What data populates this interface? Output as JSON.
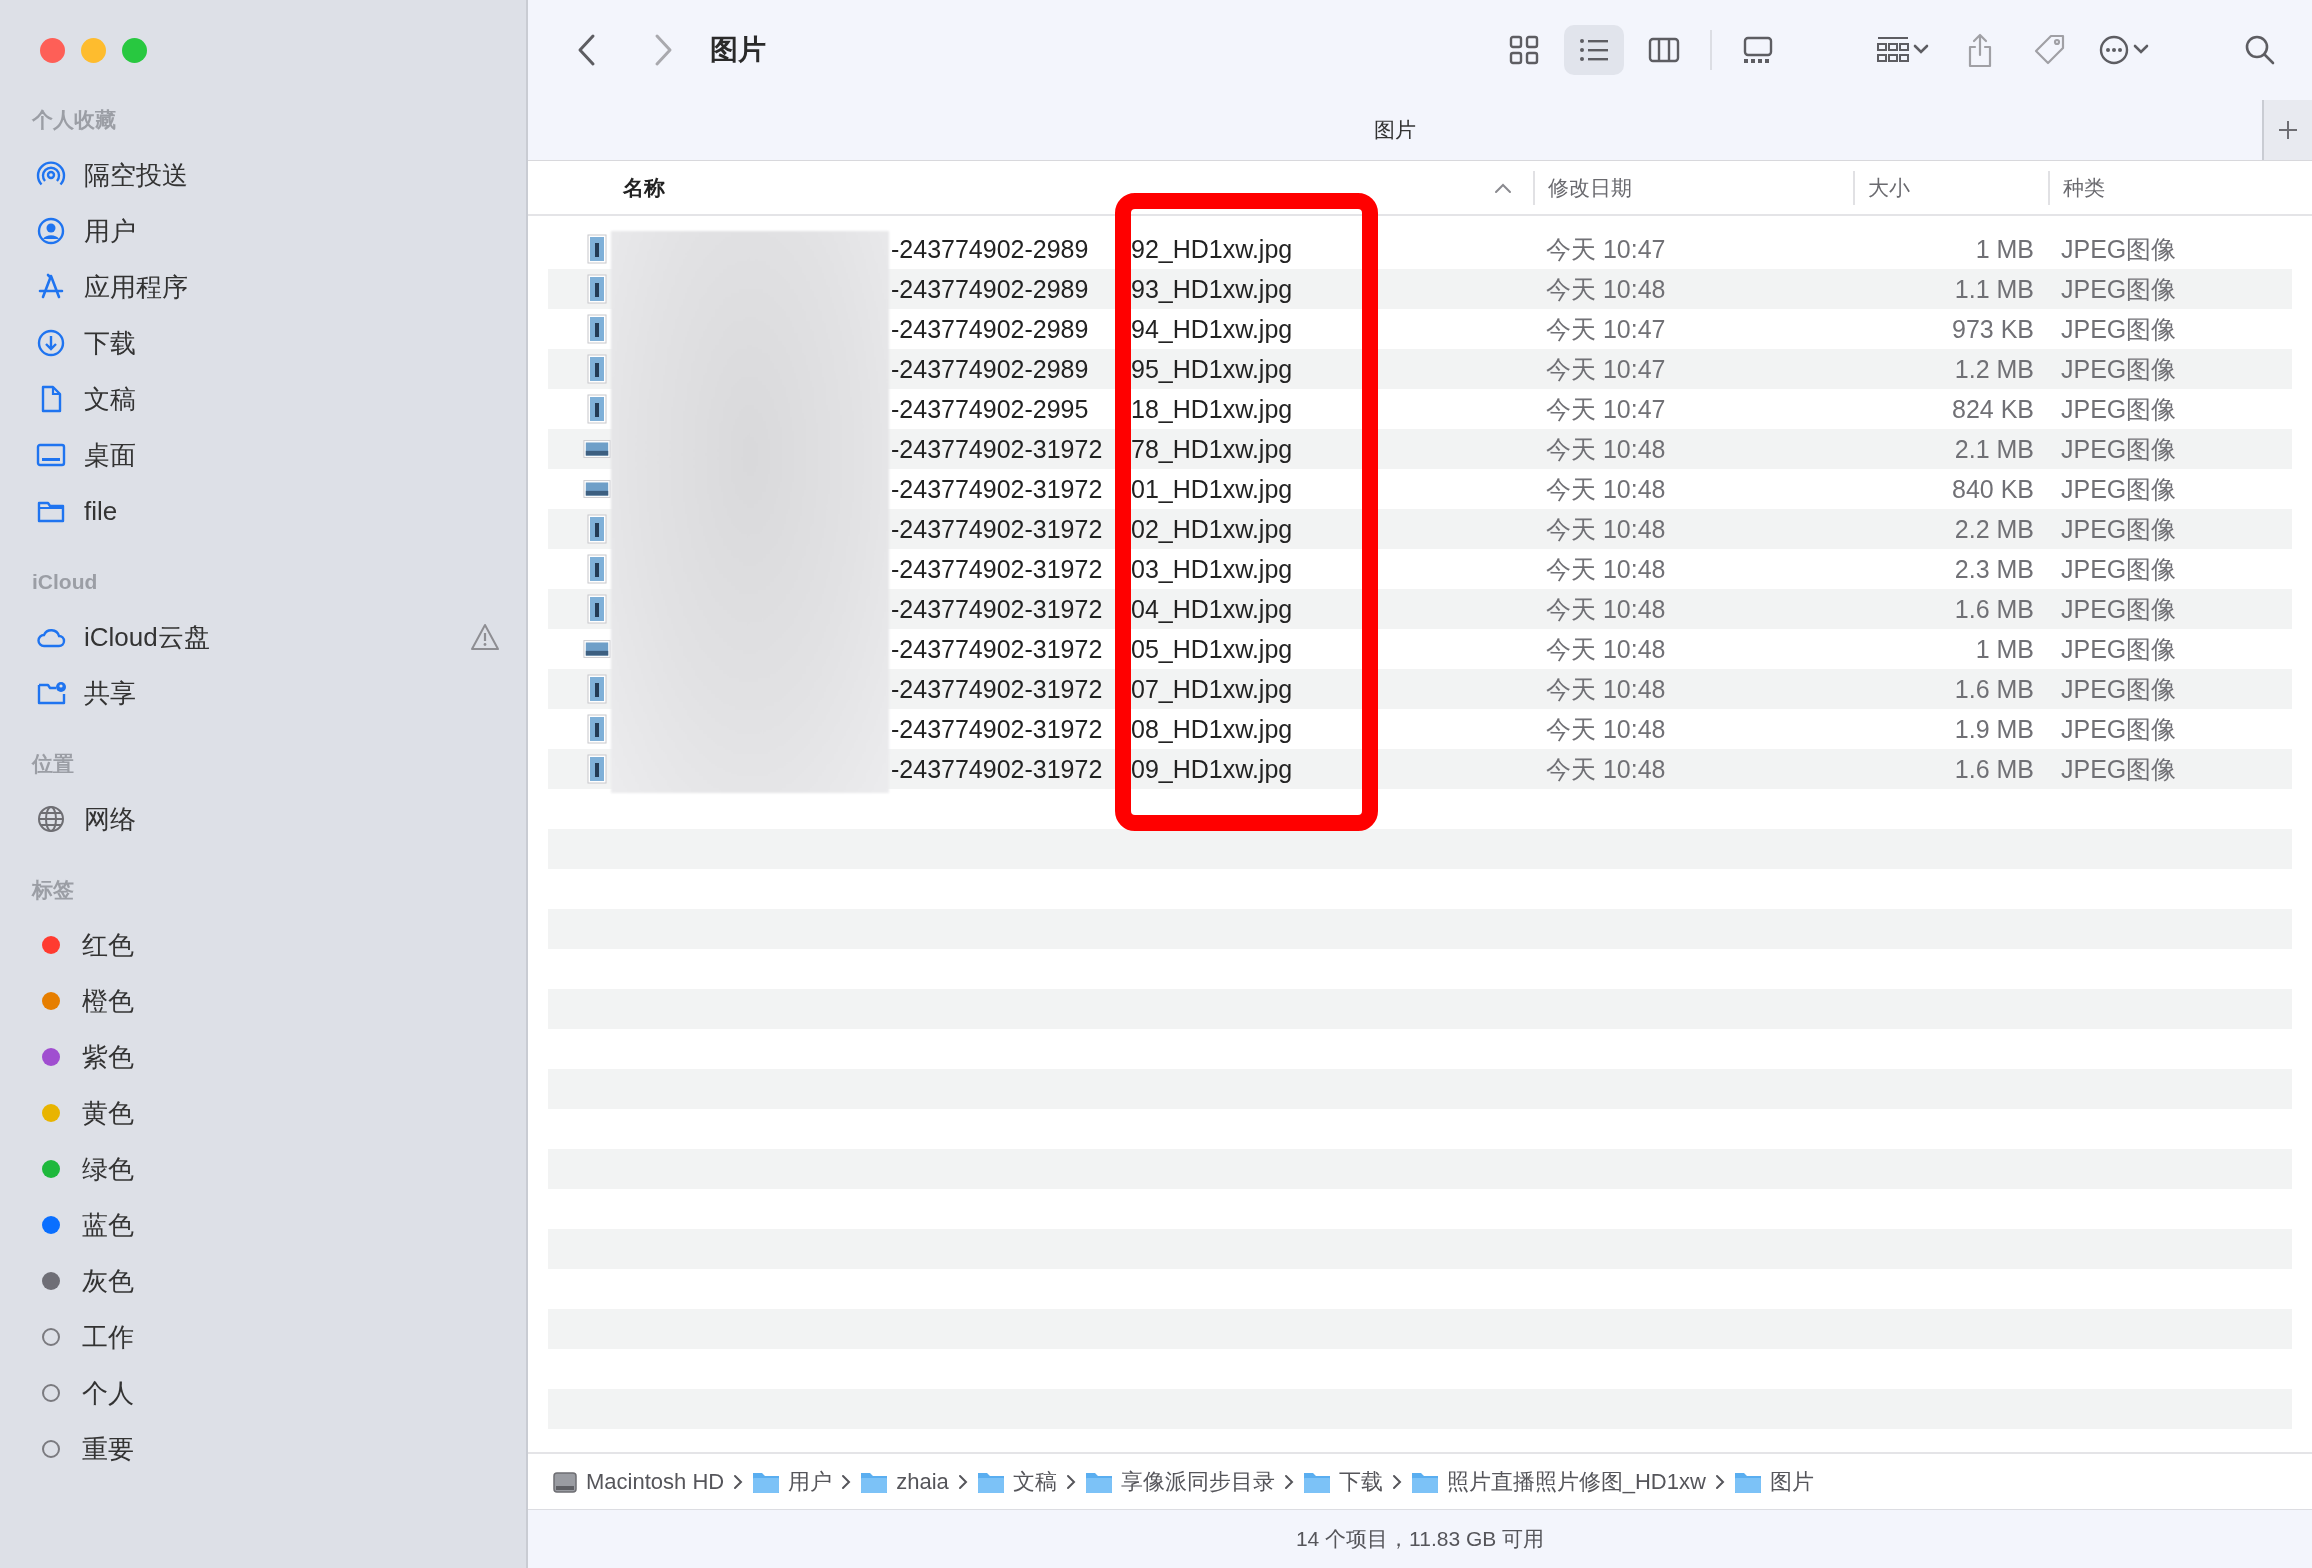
{
  "window": {
    "title": "图片"
  },
  "sidebar": {
    "sections": [
      {
        "title": "个人收藏",
        "items": [
          {
            "label": "隔空投送"
          },
          {
            "label": "用户"
          },
          {
            "label": "应用程序"
          },
          {
            "label": "下载"
          },
          {
            "label": "文稿"
          },
          {
            "label": "桌面"
          },
          {
            "label": "file"
          }
        ]
      },
      {
        "title": "iCloud",
        "items": [
          {
            "label": "iCloud云盘",
            "warning": true
          },
          {
            "label": "共享",
            "warning": false
          }
        ]
      },
      {
        "title": "位置",
        "items": [
          {
            "label": "网络"
          }
        ]
      },
      {
        "title": "标签",
        "items": [
          {
            "label": "红色",
            "color": "#ff3b30"
          },
          {
            "label": "橙色",
            "color": "#e67e00"
          },
          {
            "label": "紫色",
            "color": "#a04ed0"
          },
          {
            "label": "黄色",
            "color": "#e8b400"
          },
          {
            "label": "绿色",
            "color": "#1eb83c"
          },
          {
            "label": "蓝色",
            "color": "#0a6fff"
          },
          {
            "label": "灰色",
            "color": "#6e6e76"
          },
          {
            "label": "工作"
          },
          {
            "label": "个人"
          },
          {
            "label": "重要"
          }
        ]
      }
    ]
  },
  "toolbar": {
    "views": [
      {
        "selected": false
      },
      {
        "selected": true
      },
      {
        "selected": false
      },
      {
        "selected": false
      }
    ]
  },
  "tab": {
    "title": "图片"
  },
  "table": {
    "columns": [
      {
        "label": "名称",
        "sort_ascending": true
      },
      {
        "label": "修改日期"
      },
      {
        "label": "大小"
      },
      {
        "label": "种类"
      }
    ],
    "rows": [
      {
        "kind": "portrait",
        "name_head": "-243774902-2989",
        "name_tail": "92_HD1xw.jpg",
        "date": "今天 10:47",
        "size": "1 MB",
        "type": "JPEG图像"
      },
      {
        "kind": "portrait",
        "name_head": "-243774902-2989",
        "name_tail": "93_HD1xw.jpg",
        "date": "今天 10:48",
        "size": "1.1 MB",
        "type": "JPEG图像"
      },
      {
        "kind": "portrait",
        "name_head": "-243774902-2989",
        "name_tail": "94_HD1xw.jpg",
        "date": "今天 10:47",
        "size": "973 KB",
        "type": "JPEG图像"
      },
      {
        "kind": "portrait",
        "name_head": "-243774902-2989",
        "name_tail": "95_HD1xw.jpg",
        "date": "今天 10:47",
        "size": "1.2 MB",
        "type": "JPEG图像"
      },
      {
        "kind": "portrait",
        "name_head": "-243774902-2995",
        "name_tail": "18_HD1xw.jpg",
        "date": "今天 10:47",
        "size": "824 KB",
        "type": "JPEG图像"
      },
      {
        "kind": "landscape",
        "name_head": "-243774902-31972",
        "name_tail": "78_HD1xw.jpg",
        "date": "今天 10:48",
        "size": "2.1 MB",
        "type": "JPEG图像"
      },
      {
        "kind": "landscape",
        "name_head": "-243774902-31972",
        "name_tail": "01_HD1xw.jpg",
        "date": "今天 10:48",
        "size": "840 KB",
        "type": "JPEG图像"
      },
      {
        "kind": "portrait",
        "name_head": "-243774902-31972",
        "name_tail": "02_HD1xw.jpg",
        "date": "今天 10:48",
        "size": "2.2 MB",
        "type": "JPEG图像"
      },
      {
        "kind": "portrait",
        "name_head": "-243774902-31972",
        "name_tail": "03_HD1xw.jpg",
        "date": "今天 10:48",
        "size": "2.3 MB",
        "type": "JPEG图像"
      },
      {
        "kind": "portrait",
        "name_head": "-243774902-31972",
        "name_tail": "04_HD1xw.jpg",
        "date": "今天 10:48",
        "size": "1.6 MB",
        "type": "JPEG图像"
      },
      {
        "kind": "landscape",
        "name_head": "-243774902-31972",
        "name_tail": "05_HD1xw.jpg",
        "date": "今天 10:48",
        "size": "1 MB",
        "type": "JPEG图像"
      },
      {
        "kind": "portrait",
        "name_head": "-243774902-31972",
        "name_tail": "07_HD1xw.jpg",
        "date": "今天 10:48",
        "size": "1.6 MB",
        "type": "JPEG图像"
      },
      {
        "kind": "portrait",
        "name_head": "-243774902-31972",
        "name_tail": "08_HD1xw.jpg",
        "date": "今天 10:48",
        "size": "1.9 MB",
        "type": "JPEG图像"
      },
      {
        "kind": "portrait",
        "name_head": "-243774902-31972",
        "name_tail": "09_HD1xw.jpg",
        "date": "今天 10:48",
        "size": "1.6 MB",
        "type": "JPEG图像"
      }
    ]
  },
  "path_bar": {
    "items": [
      {
        "label": "Macintosh HD",
        "kind": "disk"
      },
      {
        "label": "用户",
        "kind": "folder"
      },
      {
        "label": "zhaia",
        "kind": "folder"
      },
      {
        "label": "文稿",
        "kind": "folder"
      },
      {
        "label": "享像派同步目录",
        "kind": "folder"
      },
      {
        "label": "下载",
        "kind": "folder"
      },
      {
        "label": "照片直播照片修图_HD1xw",
        "kind": "folder"
      },
      {
        "label": "图片",
        "kind": "folder"
      }
    ]
  },
  "status_bar": "14 个项目，11.83 GB 可用"
}
